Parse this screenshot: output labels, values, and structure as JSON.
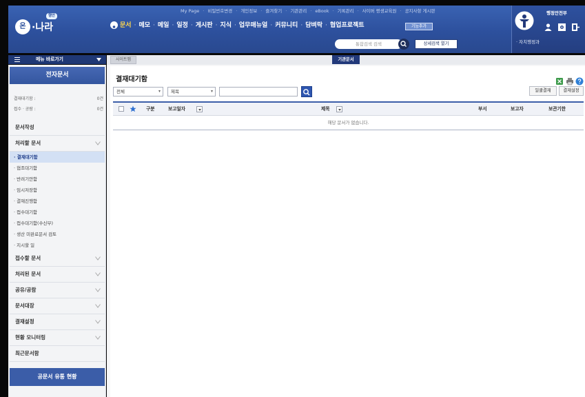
{
  "header": {
    "logo": {
      "mark": "온",
      "text": "·나라",
      "badge": "행안"
    },
    "top_links": [
      "My Page",
      "비밀번호변경",
      "개인정보",
      "즐겨찾기",
      "기관관리",
      "eBook",
      "기록관리",
      "사이버 평생교육원",
      "공지사항 게시판"
    ],
    "nav": [
      {
        "label": "문서",
        "active": true
      },
      {
        "label": "메모"
      },
      {
        "label": "메일"
      },
      {
        "label": "일정"
      },
      {
        "label": "게시판"
      },
      {
        "label": "지식"
      },
      {
        "label": "업무매뉴얼"
      },
      {
        "label": "커뮤니티"
      },
      {
        "label": "담벼락"
      },
      {
        "label": "협업프로젝트"
      }
    ],
    "nav_extra_button": "기능추가",
    "search": {
      "placeholder": "통합검색 검색",
      "detail_button": "상세검색 열기"
    },
    "org": {
      "name": "행정안전부",
      "dept": "· 자치행정과"
    }
  },
  "sidebar": {
    "shortcut_label": "메뉴 바로가기",
    "title": "전자문서",
    "counts": [
      {
        "label": "결재대기함 :",
        "value": "0건"
      },
      {
        "label": "접수 · 공람 :",
        "value": "0건"
      }
    ],
    "menu": [
      {
        "label": "문서작성"
      },
      {
        "label": "처리할 문서",
        "expanded": true,
        "children": [
          {
            "label": "결재대기함",
            "selected": true
          },
          {
            "label": "협조대기함"
          },
          {
            "label": "반려기안함"
          },
          {
            "label": "임시저장함"
          },
          {
            "label": "결재진행함"
          },
          {
            "label": "접수대기함"
          },
          {
            "label": "접수대기함(수신부)"
          },
          {
            "label": "생산 미완료문서 검토"
          },
          {
            "label": "지시할 일"
          }
        ]
      },
      {
        "label": "접수할 문서"
      },
      {
        "label": "처리된 문서"
      },
      {
        "label": "공유/공람"
      },
      {
        "label": "문서대장"
      },
      {
        "label": "결재설정"
      },
      {
        "label": "현황 모니터링"
      },
      {
        "label": "최근문서함"
      }
    ],
    "bottom_button": "공문서 유통 현황"
  },
  "main": {
    "sitemap_tab": "사이트맵",
    "org_doc_button": "기관문서",
    "page_title": "결재대기함",
    "filters": {
      "category": "전체",
      "field": "제목"
    },
    "actions": [
      "일괄결재",
      "결재설정"
    ],
    "columns": [
      "구분",
      "보고일자",
      "제목",
      "부서",
      "보고자",
      "보관기한"
    ],
    "empty_message": "해당 문서가 없습니다."
  },
  "colors": {
    "header": "#2d509d",
    "accent": "#3b5da8",
    "active_nav": "#ffd84d",
    "selected_row": "#d3e0f4"
  }
}
